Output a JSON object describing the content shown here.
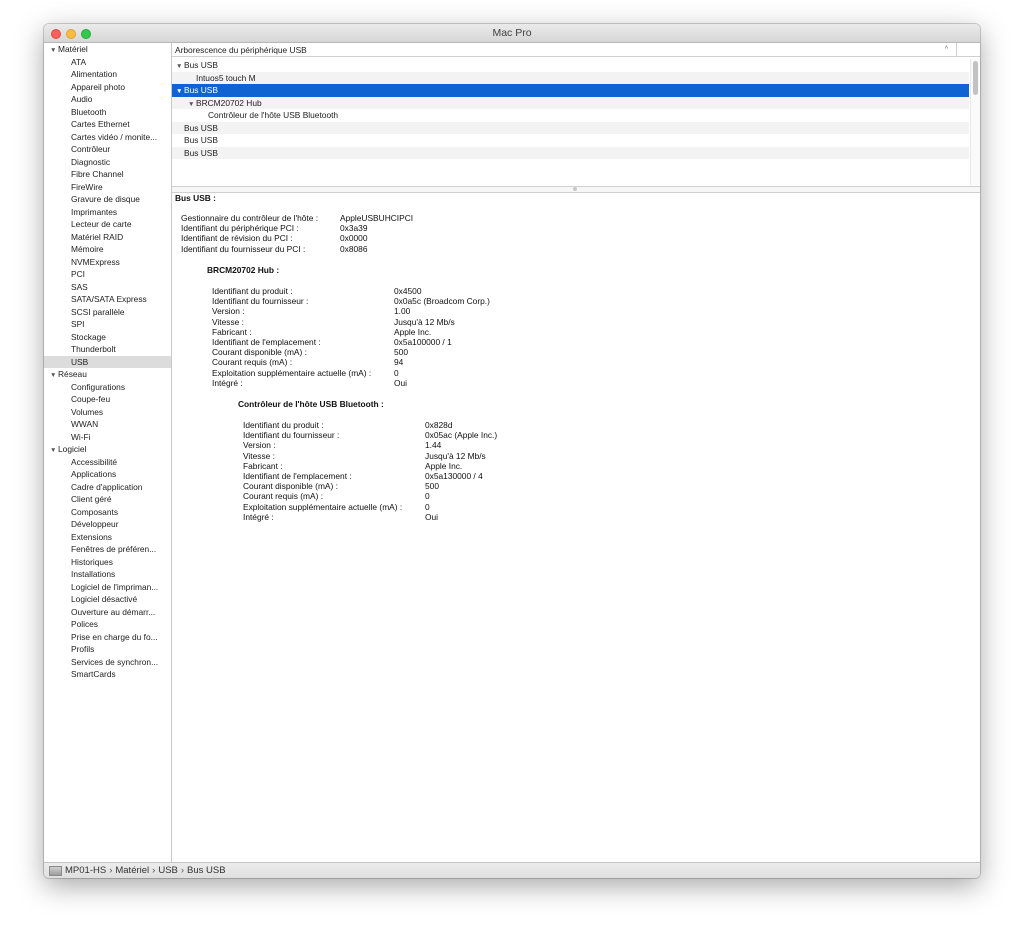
{
  "window": {
    "title": "Mac Pro"
  },
  "sidebar": {
    "categories": [
      {
        "label": "Matériel",
        "items": [
          "ATA",
          "Alimentation",
          "Appareil photo",
          "Audio",
          "Bluetooth",
          "Cartes Ethernet",
          "Cartes vidéo / monite...",
          "Contrôleur",
          "Diagnostic",
          "Fibre Channel",
          "FireWire",
          "Gravure de disque",
          "Imprimantes",
          "Lecteur de carte",
          "Matériel RAID",
          "Mémoire",
          "NVMExpress",
          "PCI",
          "SAS",
          "SATA/SATA Express",
          "SCSI parallèle",
          "SPI",
          "Stockage",
          "Thunderbolt",
          "USB"
        ]
      },
      {
        "label": "Réseau",
        "items": [
          "Configurations",
          "Coupe-feu",
          "Volumes",
          "WWAN",
          "Wi-Fi"
        ]
      },
      {
        "label": "Logiciel",
        "items": [
          "Accessibilité",
          "Applications",
          "Cadre d'application",
          "Client géré",
          "Composants",
          "Développeur",
          "Extensions",
          "Fenêtres de préféren...",
          "Historiques",
          "Installations",
          "Logiciel de l'impriman...",
          "Logiciel désactivé",
          "Ouverture au démarr...",
          "Polices",
          "Prise en charge du fo...",
          "Profils",
          "Services de synchron...",
          "SmartCards"
        ]
      }
    ],
    "selected_item": "USB"
  },
  "tree": {
    "header": "Arborescence du périphérique USB",
    "rows": [
      {
        "label": "Bus USB",
        "level": 0,
        "expanded": true
      },
      {
        "label": "Intuos5 touch M",
        "level": 1
      },
      {
        "label": "Bus USB",
        "level": 0,
        "expanded": true,
        "selected": true
      },
      {
        "label": "BRCM20702 Hub",
        "level": 1,
        "expanded": true
      },
      {
        "label": "Contrôleur de l'hôte USB Bluetooth",
        "level": 2
      },
      {
        "label": "Bus USB",
        "level": 0
      },
      {
        "label": "Bus USB",
        "level": 0
      },
      {
        "label": "Bus USB",
        "level": 0
      }
    ]
  },
  "detail": {
    "title": "Bus USB :",
    "bus_props": [
      [
        "Gestionnaire du contrôleur de l'hôte :",
        "AppleUSBUHCIPCI"
      ],
      [
        "Identifiant du périphérique PCI :",
        "0x3a39"
      ],
      [
        "Identifiant de révision du PCI :",
        "0x0000"
      ],
      [
        "Identifiant du fournisseur du PCI :",
        "0x8086"
      ]
    ],
    "hub_title": "BRCM20702 Hub :",
    "hub_props": [
      [
        "Identifiant du produit :",
        "0x4500"
      ],
      [
        "Identifiant du fournisseur :",
        "0x0a5c  (Broadcom Corp.)"
      ],
      [
        "Version :",
        "1.00"
      ],
      [
        "Vitesse :",
        "Jusqu'à 12 Mb/s"
      ],
      [
        "Fabricant :",
        "Apple Inc."
      ],
      [
        "Identifiant de l'emplacement :",
        "0x5a100000 / 1"
      ],
      [
        "Courant disponible (mA) :",
        "500"
      ],
      [
        "Courant requis (mA) :",
        "94"
      ],
      [
        "Exploitation supplémentaire actuelle (mA) :",
        "0"
      ],
      [
        "Intégré :",
        "Oui"
      ]
    ],
    "bt_title": "Contrôleur de l'hôte USB Bluetooth :",
    "bt_props": [
      [
        "Identifiant du produit :",
        "0x828d"
      ],
      [
        "Identifiant du fournisseur :",
        "0x05ac (Apple Inc.)"
      ],
      [
        "Version :",
        "1.44"
      ],
      [
        "Vitesse :",
        "Jusqu'à 12 Mb/s"
      ],
      [
        "Fabricant :",
        "Apple Inc."
      ],
      [
        "Identifiant de l'emplacement :",
        "0x5a130000 / 4"
      ],
      [
        "Courant disponible (mA) :",
        "500"
      ],
      [
        "Courant requis (mA) :",
        "0"
      ],
      [
        "Exploitation supplémentaire actuelle (mA) :",
        "0"
      ],
      [
        "Intégré :",
        "Oui"
      ]
    ]
  },
  "statusbar": {
    "crumbs": [
      "MP01-HS",
      "Matériel",
      "USB",
      "Bus USB"
    ],
    "separator": "›"
  },
  "colors": {
    "selection": "#0f64d2",
    "sidebar_selected": "#dcdcdc"
  }
}
